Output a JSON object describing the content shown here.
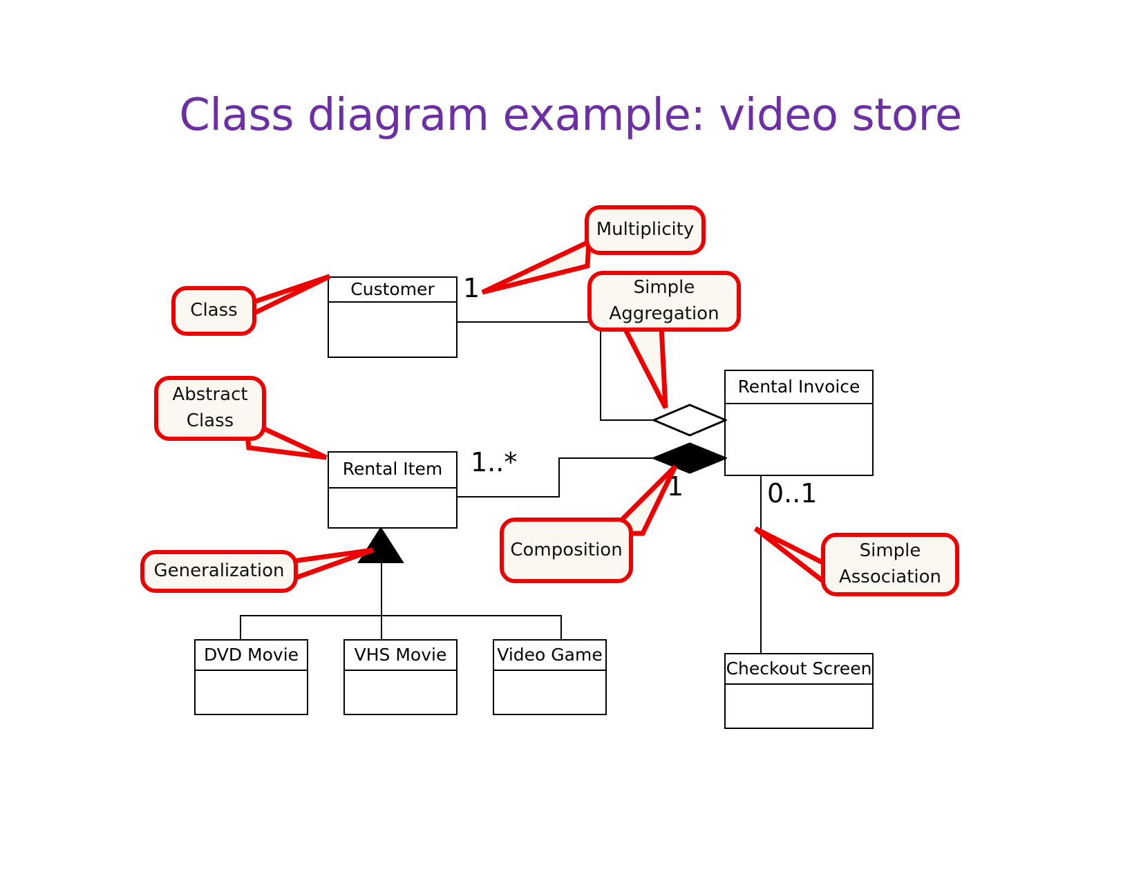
{
  "slide": {
    "title": "Class diagram example: video store",
    "title_color": "#6C2FA5",
    "background": "#FFFFFF"
  },
  "palette": {
    "annotation_red": "#EE0000",
    "callout_fill": "#FAF8F0",
    "line_black": "#000000",
    "class_fill": "#FFFFFF"
  },
  "diagram": {
    "type": "uml-class-diagram",
    "classes": [
      {
        "id": "customer",
        "name": "Customer",
        "abstract": false,
        "attributes": [],
        "operations": []
      },
      {
        "id": "rental_item",
        "name": "Rental Item",
        "abstract": true,
        "attributes": [],
        "operations": []
      },
      {
        "id": "rental_invoice",
        "name": "Rental Invoice",
        "abstract": false,
        "attributes": [],
        "operations": []
      },
      {
        "id": "dvd_movie",
        "name": "DVD Movie",
        "abstract": false,
        "attributes": [],
        "operations": []
      },
      {
        "id": "vhs_movie",
        "name": "VHS Movie",
        "abstract": false,
        "attributes": [],
        "operations": []
      },
      {
        "id": "video_game",
        "name": "Video Game",
        "abstract": false,
        "attributes": [],
        "operations": []
      },
      {
        "id": "checkout_screen",
        "name": "Checkout Screen",
        "abstract": false,
        "attributes": [],
        "operations": []
      }
    ],
    "relationships": [
      {
        "id": "r1",
        "kind": "aggregation",
        "from": "customer",
        "to": "rental_invoice",
        "from_multiplicity": "1",
        "to_multiplicity": ""
      },
      {
        "id": "r2",
        "kind": "composition",
        "from": "rental_item",
        "to": "rental_invoice",
        "from_multiplicity": "1..*",
        "to_multiplicity": "1"
      },
      {
        "id": "r3",
        "kind": "association",
        "from": "rental_invoice",
        "to": "checkout_screen",
        "from_multiplicity": "0..1",
        "to_multiplicity": ""
      },
      {
        "id": "r4",
        "kind": "generalization",
        "from": "dvd_movie",
        "to": "rental_item",
        "from_multiplicity": "",
        "to_multiplicity": ""
      },
      {
        "id": "r5",
        "kind": "generalization",
        "from": "vhs_movie",
        "to": "rental_item",
        "from_multiplicity": "",
        "to_multiplicity": ""
      },
      {
        "id": "r6",
        "kind": "generalization",
        "from": "video_game",
        "to": "rental_item",
        "from_multiplicity": "",
        "to_multiplicity": ""
      }
    ],
    "multiplicity_labels": {
      "customer_end": "1",
      "rental_item_end": "1..*",
      "invoice_composition_end": "1",
      "invoice_association_end": "0..1"
    }
  },
  "callouts": [
    {
      "id": "multiplicity",
      "lines": [
        "Multiplicity"
      ],
      "points_to": "customer_multiplicity_1"
    },
    {
      "id": "class",
      "lines": [
        "Class"
      ],
      "points_to": "customer_class_box"
    },
    {
      "id": "simple_aggregation",
      "lines": [
        "Simple",
        "Aggregation"
      ],
      "points_to": "aggregation_diamond"
    },
    {
      "id": "abstract_class",
      "lines": [
        "Abstract",
        "Class"
      ],
      "points_to": "rental_item_class_box"
    },
    {
      "id": "generalization",
      "lines": [
        "Generalization"
      ],
      "points_to": "generalization_triangle"
    },
    {
      "id": "composition",
      "lines": [
        "Composition"
      ],
      "points_to": "composition_diamond"
    },
    {
      "id": "simple_association",
      "lines": [
        "Simple",
        "Association"
      ],
      "points_to": "association_line"
    }
  ]
}
